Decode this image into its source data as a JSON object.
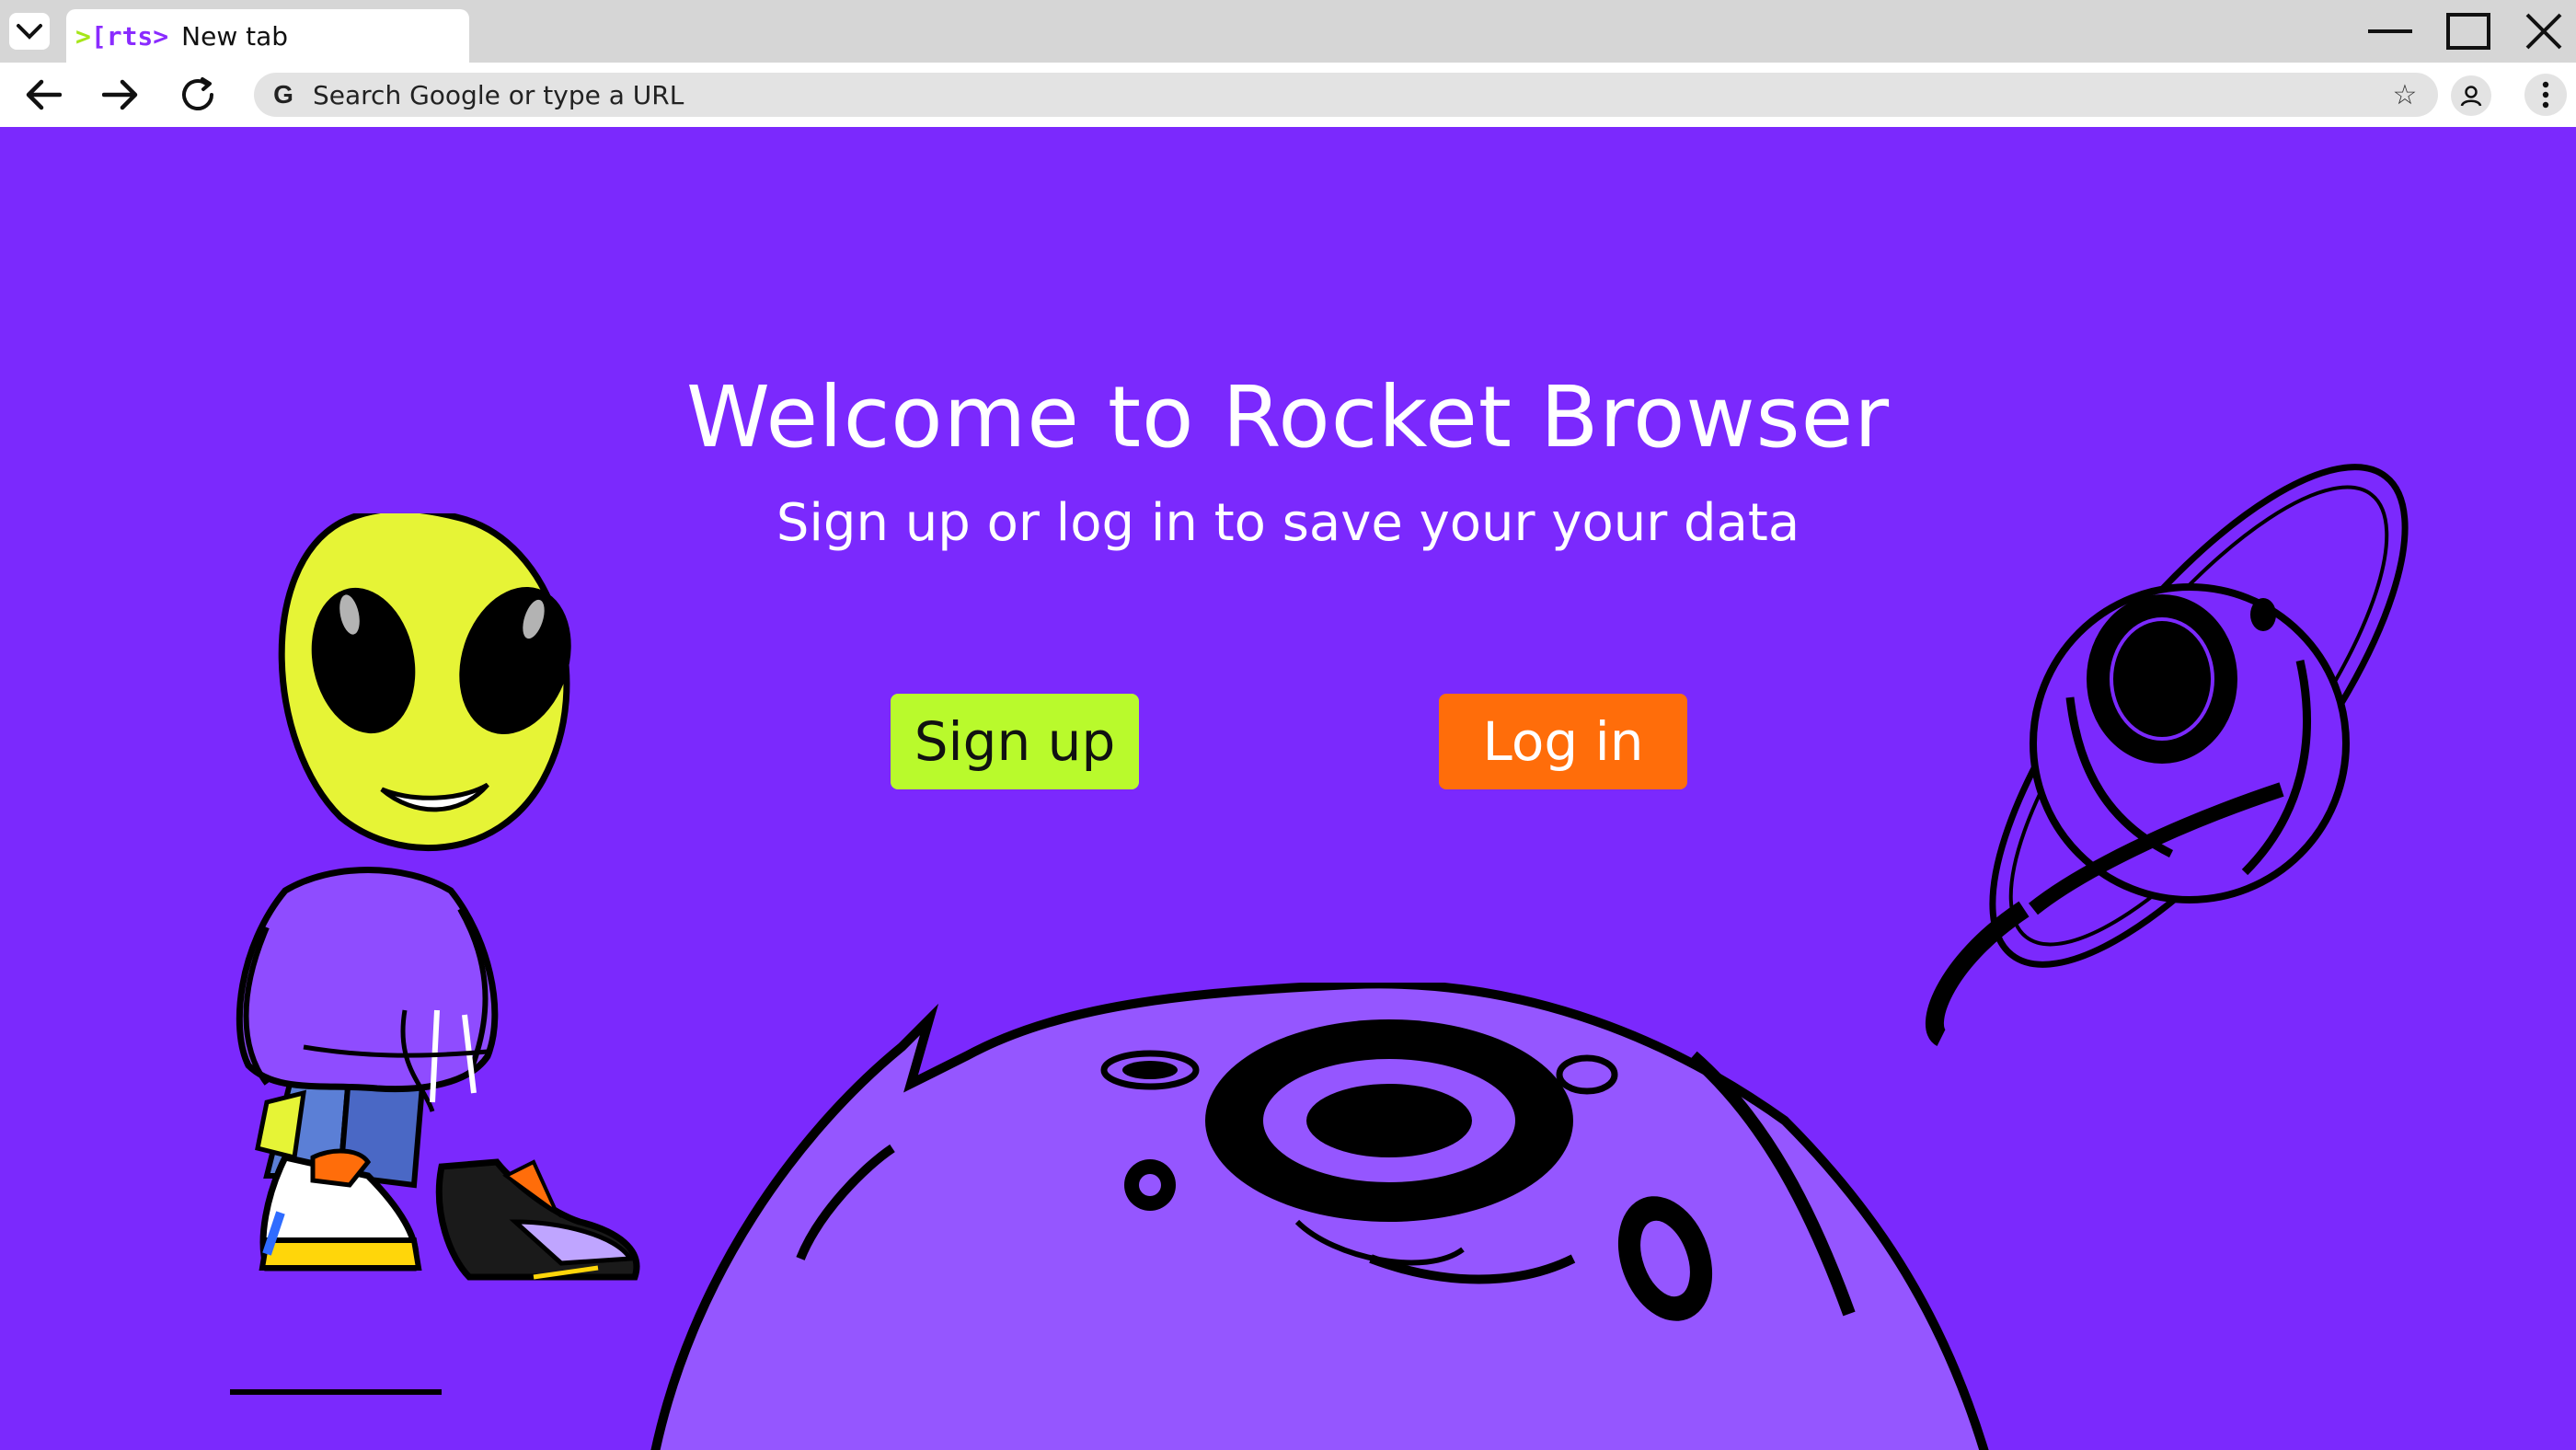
{
  "browser": {
    "tab": {
      "logo": {
        "gt": ">",
        "rest": "[rts>"
      },
      "title": "New tab"
    },
    "omnibox": {
      "placeholder": "Search Google or type a URL",
      "value": ""
    },
    "icons": {
      "tab_menu": "chevron-down-icon",
      "minimize": "minimize-icon",
      "maximize": "maximize-icon",
      "close": "close-icon",
      "back": "back-arrow-icon",
      "forward": "forward-arrow-icon",
      "reload": "reload-icon",
      "search_engine": "google-g-icon",
      "bookmark": "star-icon",
      "profile": "profile-icon",
      "menu": "kebab-menu-icon"
    },
    "search_engine_glyph": "G",
    "bookmark_glyph": "☆"
  },
  "page": {
    "headline": "Welcome to Rocket Browser",
    "subline": "Sign up or log in to save your your data",
    "signup_label": "Sign up",
    "login_label": "Log in",
    "colors": {
      "background": "#7b29fd",
      "signup_button": "#b9fa2c",
      "login_button": "#ff6d0a",
      "planet": "#9556ff",
      "alien_skin": "#e6f436"
    },
    "illustrations": [
      "alien-illustration",
      "ringed-planet-illustration",
      "moon-illustration"
    ]
  }
}
